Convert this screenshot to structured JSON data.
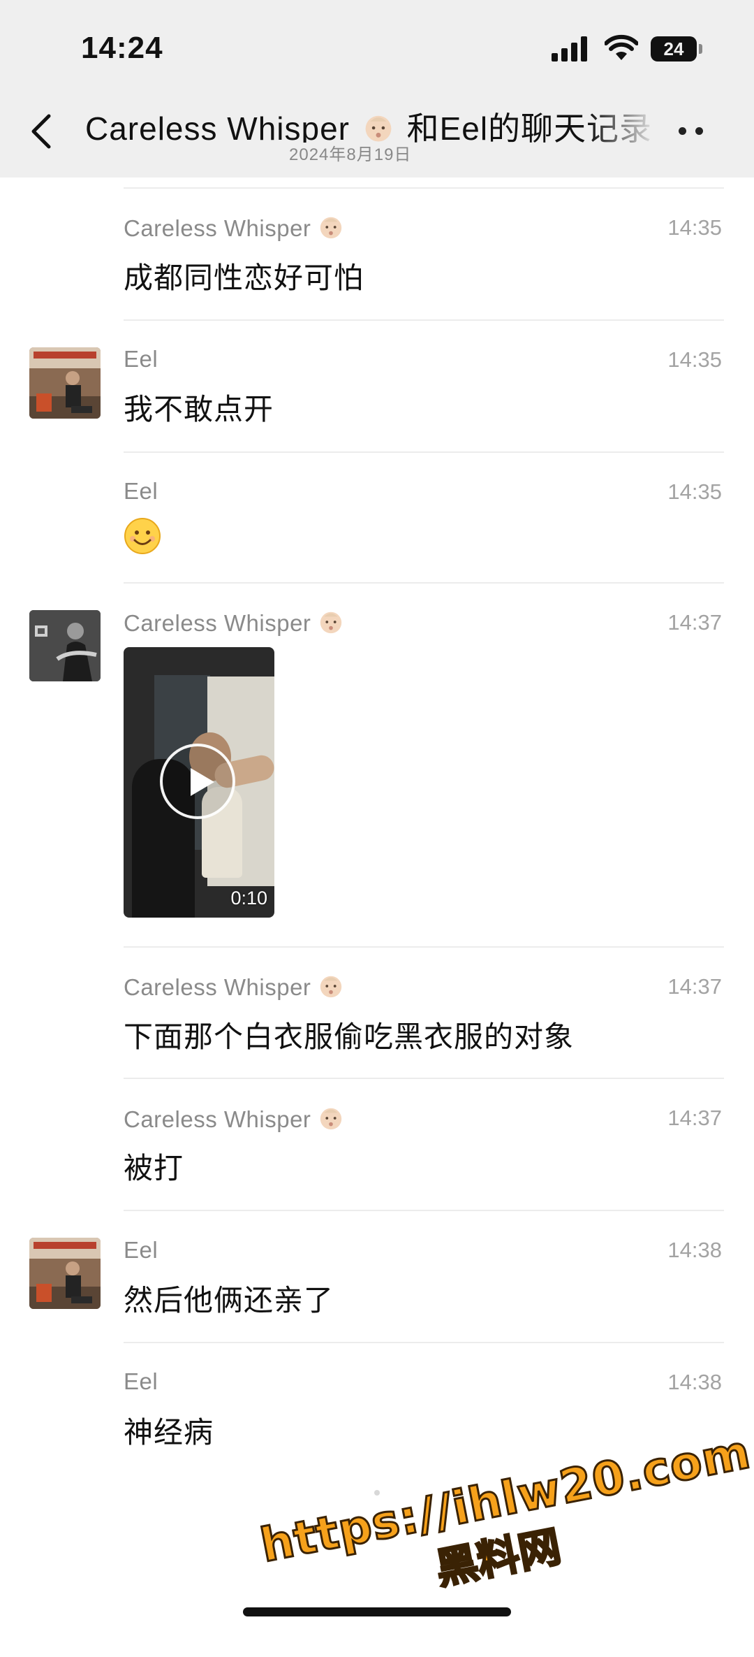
{
  "status_bar": {
    "time": "14:24",
    "battery": "24"
  },
  "header": {
    "title_prefix": "Careless  Whisper",
    "title_suffix": "和Eel的聊天记录",
    "date": "2024年8月19日"
  },
  "messages": [
    {
      "sender": "Careless  Whisper",
      "time": "14:35",
      "text": "成都同性恋好可怕"
    },
    {
      "sender": "Eel",
      "time": "14:35",
      "text": "我不敢点开"
    },
    {
      "sender": "Eel",
      "time": "14:35",
      "text": "smiling-face-emoji"
    },
    {
      "sender": "Careless  Whisper",
      "time": "14:37",
      "type": "video",
      "duration": "0:10"
    },
    {
      "sender": "Careless  Whisper",
      "time": "14:37",
      "text": "下面那个白衣服偷吃黑衣服的对象"
    },
    {
      "sender": "Careless  Whisper",
      "time": "14:37",
      "text": "被打"
    },
    {
      "sender": "Eel",
      "time": "14:38",
      "text": "然后他俩还亲了"
    },
    {
      "sender": "Eel",
      "time": "14:38",
      "text": "神经病"
    }
  ],
  "watermark": {
    "url": "https://ihlw20.com",
    "name": "黑料网"
  },
  "colors": {
    "header_bg": "#efefef",
    "divider": "#ececec",
    "sender_gray": "#8a8a8a",
    "time_gray": "#a3a3a3",
    "watermark_orange": "#f6a11b"
  }
}
